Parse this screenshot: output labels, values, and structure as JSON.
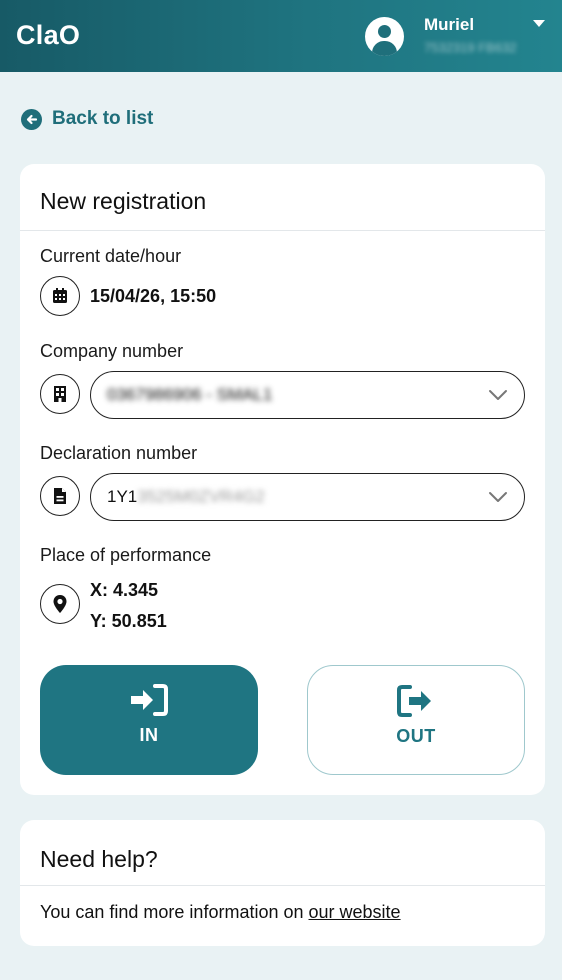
{
  "header": {
    "brand": "ClaO",
    "user_name": "Muriel",
    "user_id_obscured": "7532319 FB632"
  },
  "nav": {
    "back_label": "Back to list"
  },
  "registration": {
    "title": "New registration",
    "date": {
      "label": "Current date/hour",
      "value": "15/04/26, 15:50"
    },
    "company": {
      "label": "Company number",
      "value_obscured": "0367986906 - SMAL1"
    },
    "declaration": {
      "label": "Declaration number",
      "prefix": "1Y1",
      "value_obscured": "3525M0ZVR4G2"
    },
    "place": {
      "label": "Place of performance",
      "x": "X: 4.345",
      "y": "Y: 50.851"
    },
    "actions": {
      "in_label": "IN",
      "out_label": "OUT"
    }
  },
  "help": {
    "title": "Need help?",
    "text": "You can find more information on ",
    "link": "our website"
  },
  "colors": {
    "primary": "#1f7582",
    "header_start": "#175a66",
    "background": "#e9f2f4"
  }
}
